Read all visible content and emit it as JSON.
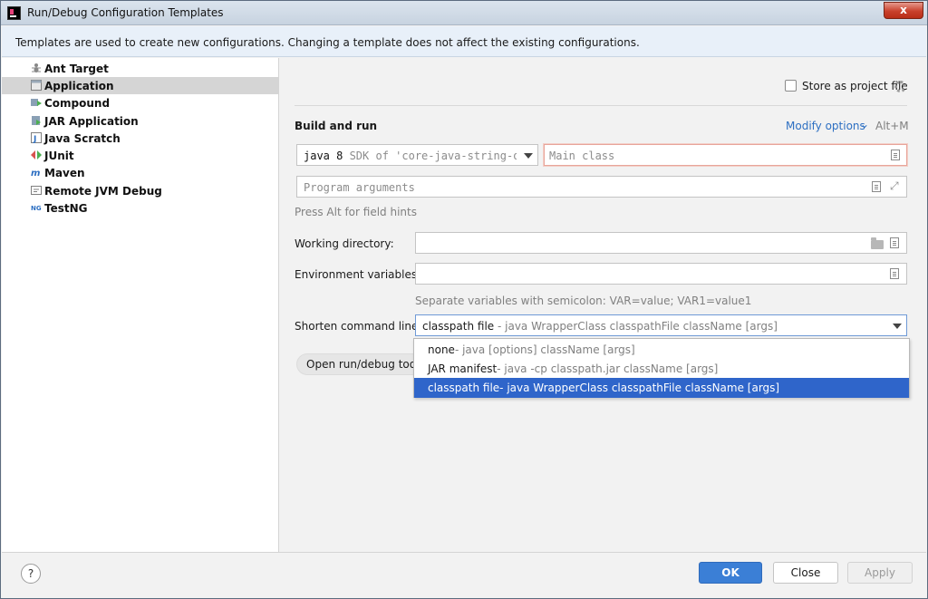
{
  "window": {
    "title": "Run/Debug Configuration Templates",
    "close_label": "x"
  },
  "banner": {
    "text": "Templates are used to create new configurations. Changing a template does not affect the existing configurations."
  },
  "sidebar": {
    "items": [
      {
        "label": "Ant Target",
        "icon": "ant-icon",
        "selected": false
      },
      {
        "label": "Application",
        "icon": "application-icon",
        "selected": true
      },
      {
        "label": "Compound",
        "icon": "compound-icon",
        "selected": false
      },
      {
        "label": "JAR Application",
        "icon": "jar-icon",
        "selected": false
      },
      {
        "label": "Java Scratch",
        "icon": "java-scratch-icon",
        "selected": false
      },
      {
        "label": "JUnit",
        "icon": "junit-icon",
        "selected": false
      },
      {
        "label": "Maven",
        "icon": "maven-icon",
        "selected": false
      },
      {
        "label": "Remote JVM Debug",
        "icon": "remote-debug-icon",
        "selected": false
      },
      {
        "label": "TestNG",
        "icon": "testng-icon",
        "selected": false
      }
    ]
  },
  "main": {
    "store_as_project_file": "Store as project file",
    "build_and_run": "Build and run",
    "modify_options": "Modify options",
    "modify_options_shortcut": "Alt+M",
    "sdk_value_bold": "java 8",
    "sdk_value_rest": " SDK of 'core-java-string-ope",
    "main_class_placeholder": "Main class",
    "program_arguments_placeholder": "Program arguments",
    "field_hint": "Press Alt for field hints",
    "working_directory_label": "Working directory:",
    "environment_variables_label": "Environment variables:",
    "env_hint": "Separate variables with semicolon: VAR=value; VAR1=value1",
    "shorten_command_line_label": "Shorten command line:",
    "shorten_value": "classpath file",
    "shorten_value_hint": " - java WrapperClass classpathFile className [args]",
    "open_tool_window": "Open run/debug tool w"
  },
  "popup": {
    "options": [
      {
        "name": "none",
        "hint": " - java [options] className [args]",
        "selected": false
      },
      {
        "name": "JAR manifest",
        "hint": " - java -cp classpath.jar className [args]",
        "selected": false
      },
      {
        "name": "classpath file",
        "hint": " - java WrapperClass classpathFile className [args]",
        "selected": true
      }
    ]
  },
  "footer": {
    "help": "?",
    "ok": "OK",
    "close": "Close",
    "apply": "Apply"
  },
  "colors": {
    "accent": "#3b7fd6",
    "selection": "#2f65ca",
    "link": "#2d6fc2",
    "error_border": "#e8a59a"
  }
}
